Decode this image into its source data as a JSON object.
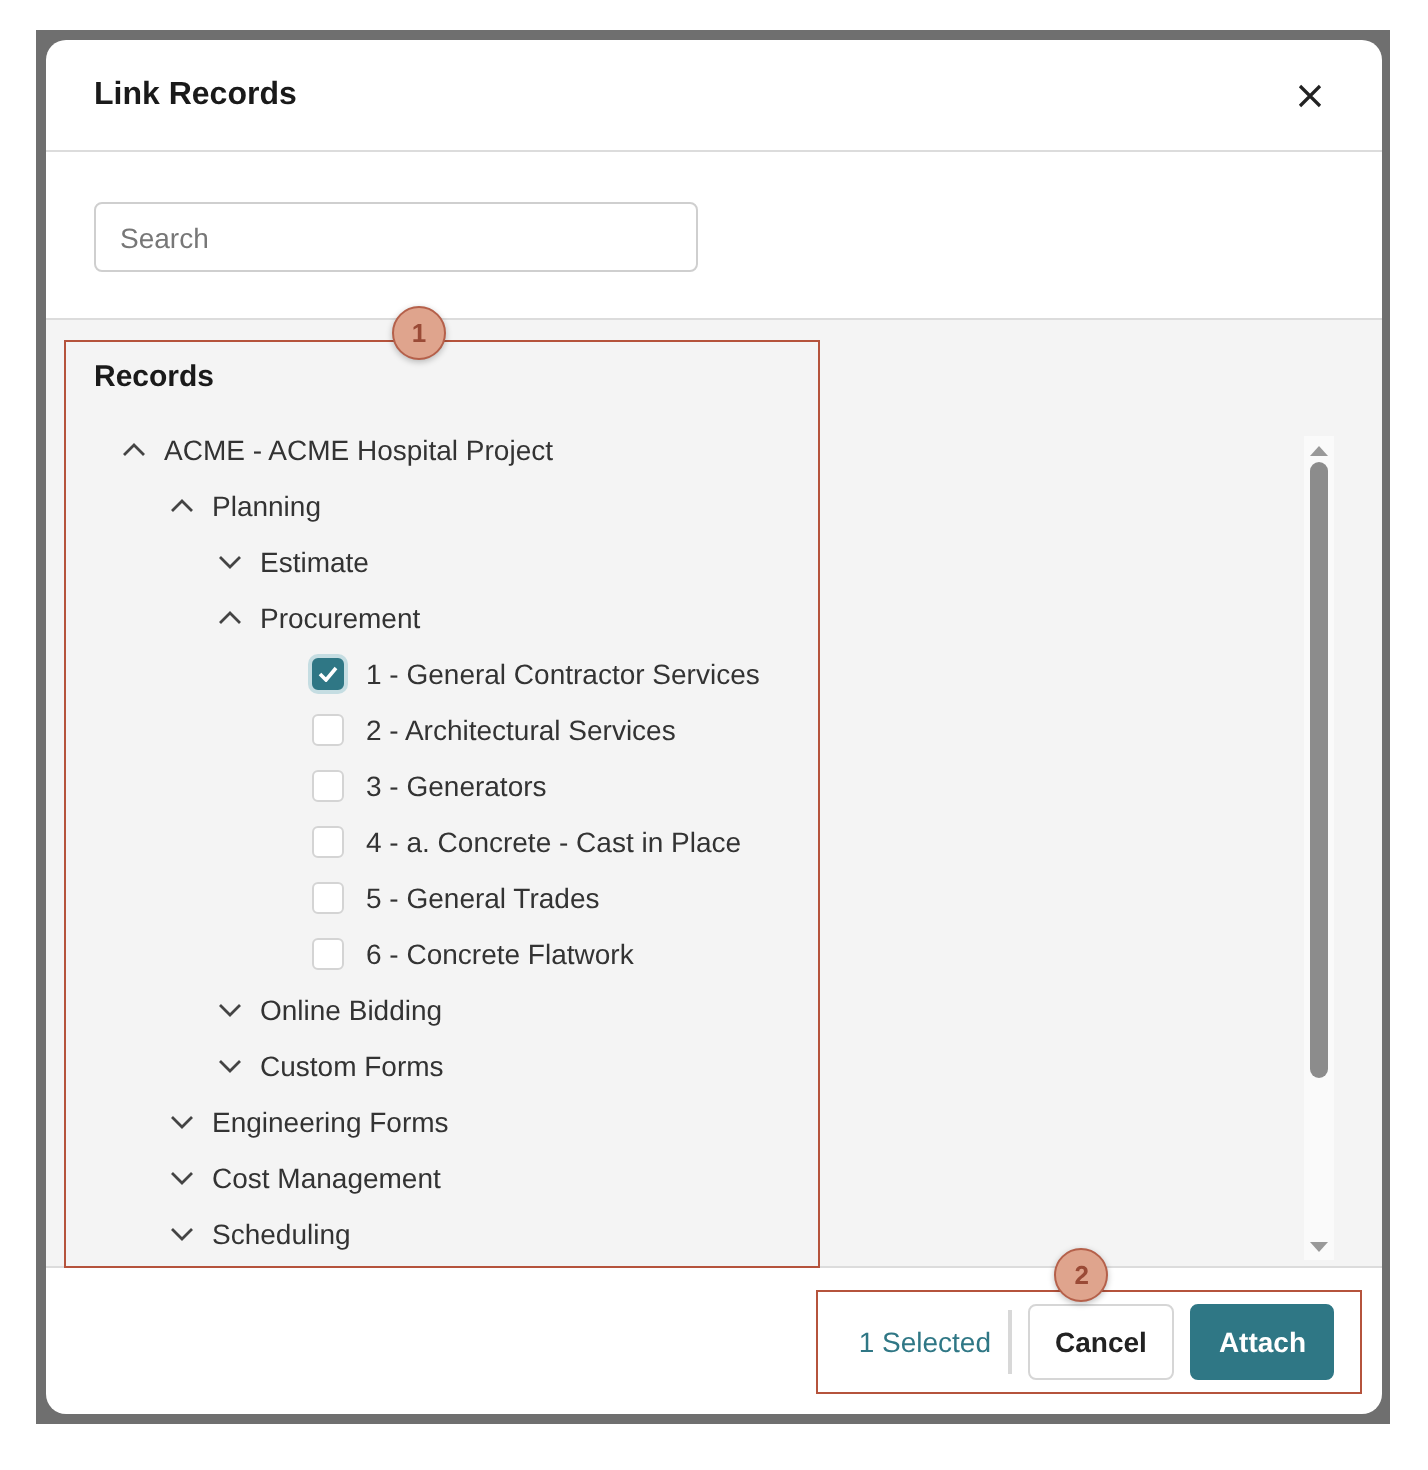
{
  "dialog": {
    "title": "Link Records"
  },
  "search": {
    "placeholder": "Search"
  },
  "tree": {
    "heading": "Records",
    "callout": "1",
    "items": [
      {
        "kind": "group",
        "label": "ACME - ACME Hospital Project",
        "expanded": true,
        "children": [
          {
            "kind": "group",
            "label": "Planning",
            "expanded": true,
            "children": [
              {
                "kind": "group",
                "label": "Estimate",
                "expanded": false
              },
              {
                "kind": "group",
                "label": "Procurement",
                "expanded": true,
                "children": [
                  {
                    "kind": "record",
                    "label": "1 - General Contractor Services",
                    "checked": true
                  },
                  {
                    "kind": "record",
                    "label": "2 - Architectural Services",
                    "checked": false
                  },
                  {
                    "kind": "record",
                    "label": "3 - Generators",
                    "checked": false
                  },
                  {
                    "kind": "record",
                    "label": "4 - a. Concrete - Cast in Place",
                    "checked": false
                  },
                  {
                    "kind": "record",
                    "label": "5 - General Trades",
                    "checked": false
                  },
                  {
                    "kind": "record",
                    "label": "6 - Concrete Flatwork",
                    "checked": false
                  }
                ]
              },
              {
                "kind": "group",
                "label": "Online Bidding",
                "expanded": false
              },
              {
                "kind": "group",
                "label": "Custom Forms",
                "expanded": false
              }
            ]
          },
          {
            "kind": "group",
            "label": "Engineering Forms",
            "expanded": false
          },
          {
            "kind": "group",
            "label": "Cost Management",
            "expanded": false
          },
          {
            "kind": "group",
            "label": "Scheduling",
            "expanded": false
          }
        ]
      }
    ]
  },
  "footer": {
    "callout": "2",
    "selected_count": "1 Selected",
    "buttons": [
      {
        "kind": "secondary",
        "label": "Cancel"
      },
      {
        "kind": "primary",
        "label": "Attach"
      }
    ]
  }
}
